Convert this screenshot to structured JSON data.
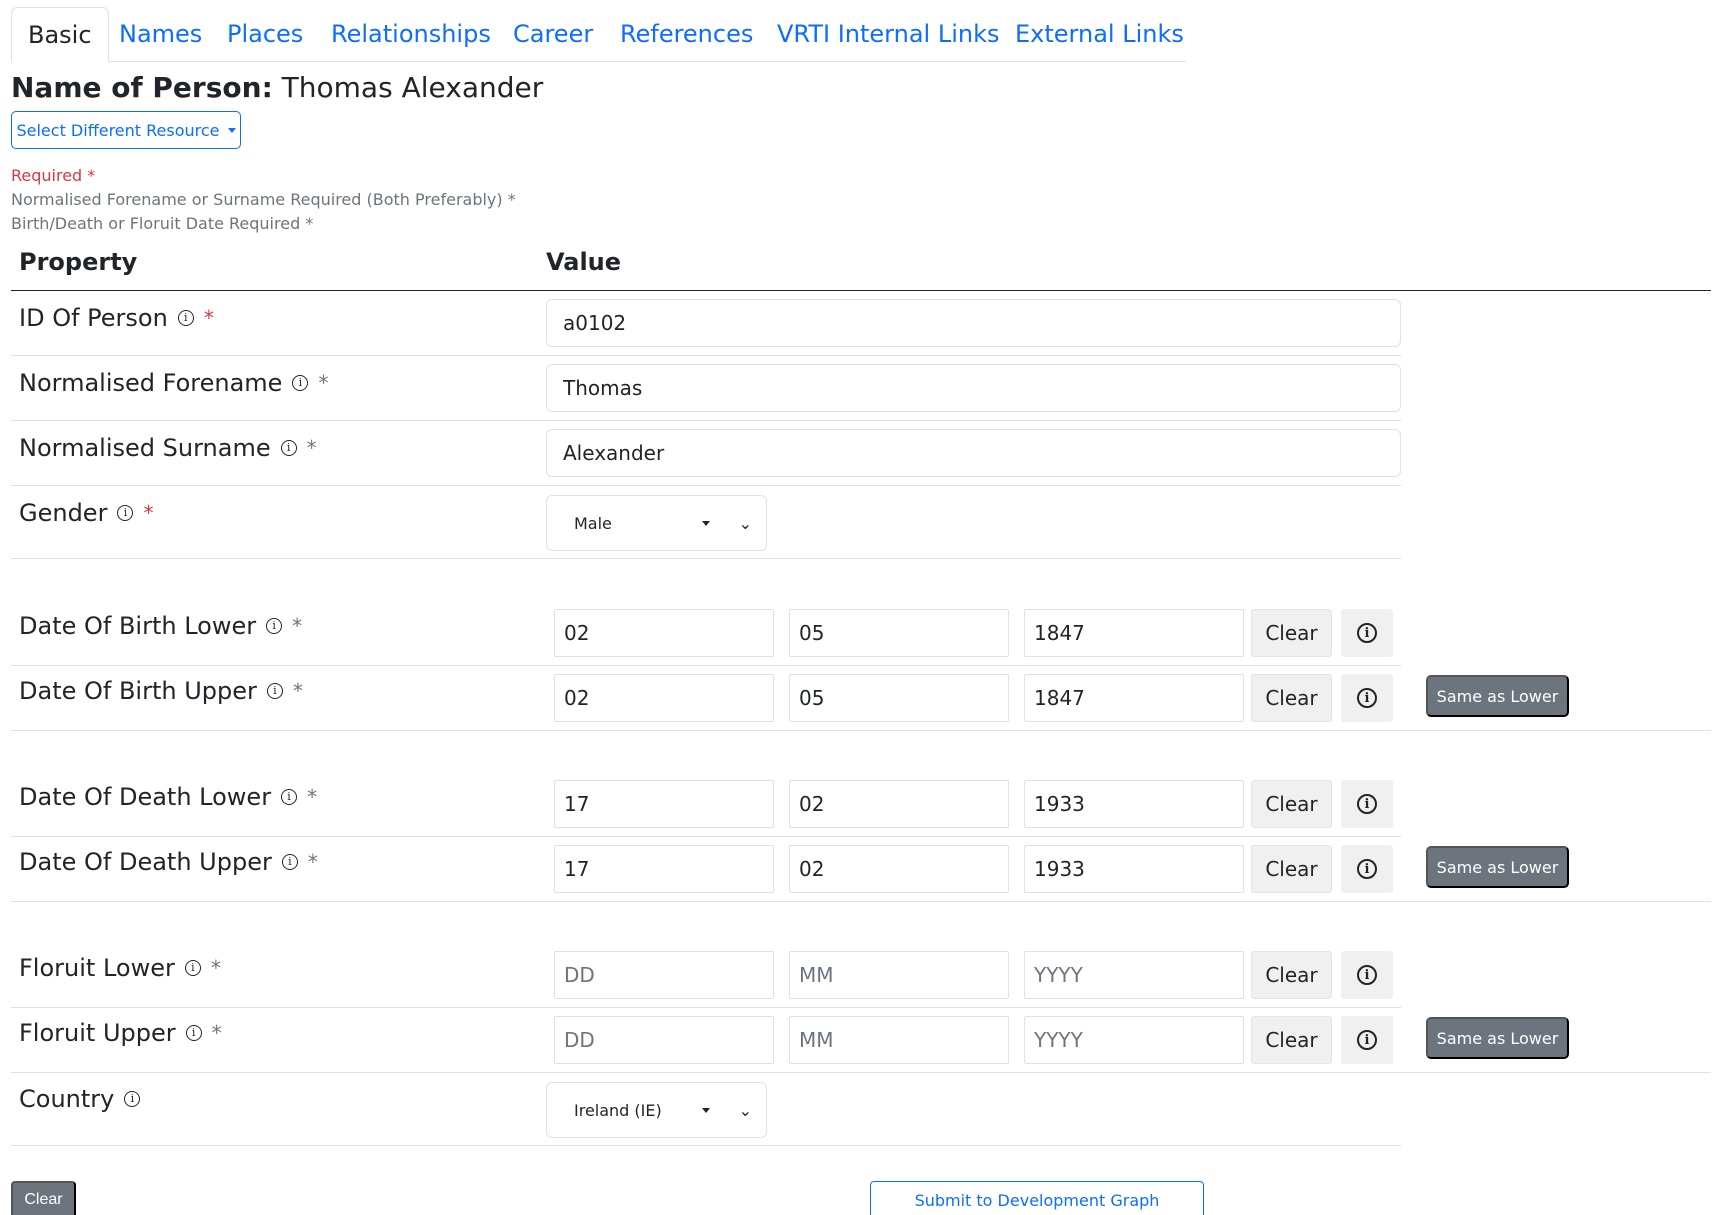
{
  "tabs": [
    "Basic",
    "Names",
    "Places",
    "Relationships",
    "Career",
    "References",
    "VRTI Internal Links",
    "External Links"
  ],
  "person": {
    "label": "Name of Person:",
    "name": "Thomas Alexander"
  },
  "select_resource_label": "Select Different Resource",
  "requirements": {
    "required": "Required *",
    "names": "Normalised Forename or Surname Required (Both Preferably) *",
    "dates": "Birth/Death or Floruit Date Required *"
  },
  "table_headers": {
    "property": "Property",
    "value": "Value"
  },
  "fields": {
    "id": {
      "label": "ID Of Person",
      "value": "a0102",
      "star": "*"
    },
    "forename": {
      "label": "Normalised Forename",
      "value": "Thomas",
      "star": "*"
    },
    "surname": {
      "label": "Normalised Surname",
      "value": "Alexander",
      "star": "*"
    },
    "gender": {
      "label": "Gender",
      "value": "Male",
      "star": "*"
    },
    "country": {
      "label": "Country",
      "value": "Ireland (IE)"
    }
  },
  "dates": {
    "birth_lower": {
      "label": "Date Of Birth Lower",
      "day": "02",
      "month": "05",
      "year": "1847"
    },
    "birth_upper": {
      "label": "Date Of Birth Upper",
      "day": "02",
      "month": "05",
      "year": "1847"
    },
    "death_lower": {
      "label": "Date Of Death Lower",
      "day": "17",
      "month": "02",
      "year": "1933"
    },
    "death_upper": {
      "label": "Date Of Death Upper",
      "day": "17",
      "month": "02",
      "year": "1933"
    },
    "floruit_lower": {
      "label": "Floruit Lower",
      "day": "",
      "month": "",
      "year": ""
    },
    "floruit_upper": {
      "label": "Floruit Upper",
      "day": "",
      "month": "",
      "year": ""
    }
  },
  "placeholders": {
    "day": "DD",
    "month": "MM",
    "year": "YYYY"
  },
  "star": "*",
  "info_glyph": "i",
  "buttons": {
    "clear": "Clear",
    "same_as_lower": "Same as Lower",
    "clear_all": "Clear",
    "submit": "Submit to Development Graph"
  },
  "colors": {
    "primary": "#0d6efd",
    "secondary": "#6c757d",
    "danger": "#dc3545"
  }
}
